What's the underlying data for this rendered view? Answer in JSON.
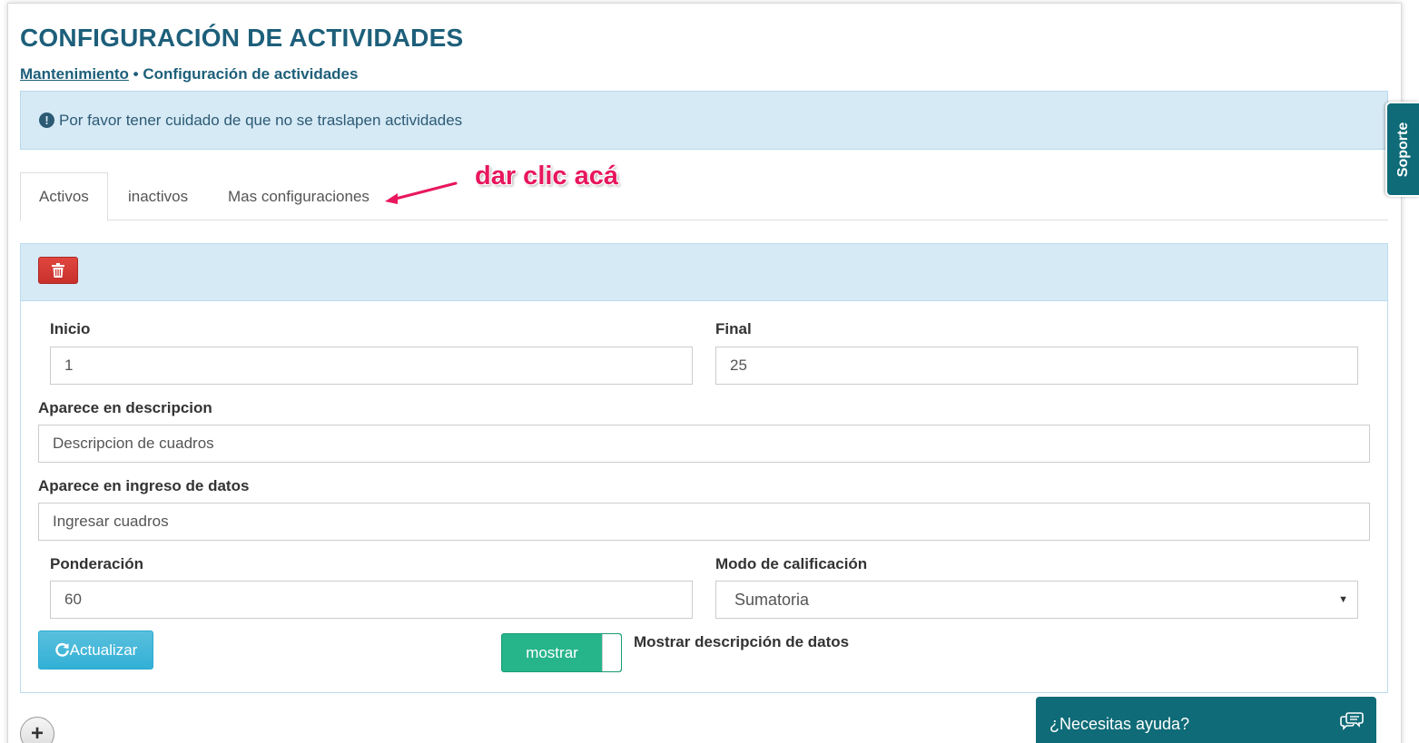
{
  "page": {
    "title": "CONFIGURACIÓN DE ACTIVIDADES",
    "breadcrumb": {
      "link": "Mantenimiento",
      "separator": " • ",
      "current": "Configuración de actividades"
    }
  },
  "alert": {
    "icon": "exclamation-circle-icon",
    "text": "Por favor tener cuidado de que no se traslapen actividades"
  },
  "tabs": [
    {
      "label": "Activos",
      "active": true
    },
    {
      "label": "inactivos",
      "active": false
    },
    {
      "label": "Mas configuraciones",
      "active": false
    }
  ],
  "annotation": {
    "text": "dar clic acá",
    "color": "#e8175d"
  },
  "panel": {
    "delete_icon": "trash-icon",
    "fields": {
      "inicio": {
        "label": "Inicio",
        "value": "1"
      },
      "final": {
        "label": "Final",
        "value": "25"
      },
      "descripcion": {
        "label": "Aparece en descripcion",
        "value": "Descripcion de cuadros"
      },
      "ingreso": {
        "label": "Aparece en ingreso de datos",
        "value": "Ingresar cuadros"
      },
      "ponderacion": {
        "label": "Ponderación",
        "value": "60"
      },
      "modo": {
        "label": "Modo de calificación",
        "value": "Sumatoria"
      }
    },
    "update_button": "Actualizar",
    "toggle": {
      "label": "mostrar",
      "on": true,
      "description": "Mostrar descripción de datos"
    }
  },
  "add_button": "+",
  "support_tab": "Soporte",
  "help_widget": {
    "text": "¿Necesitas ayuda?",
    "icon": "chat-bubbles-icon"
  },
  "colors": {
    "primary": "#1d5f7a",
    "alert_bg": "#d6eaf6",
    "danger": "#c9302c",
    "info": "#31b0d5",
    "toggle_on": "#26b48a",
    "support": "#0e6b77"
  }
}
